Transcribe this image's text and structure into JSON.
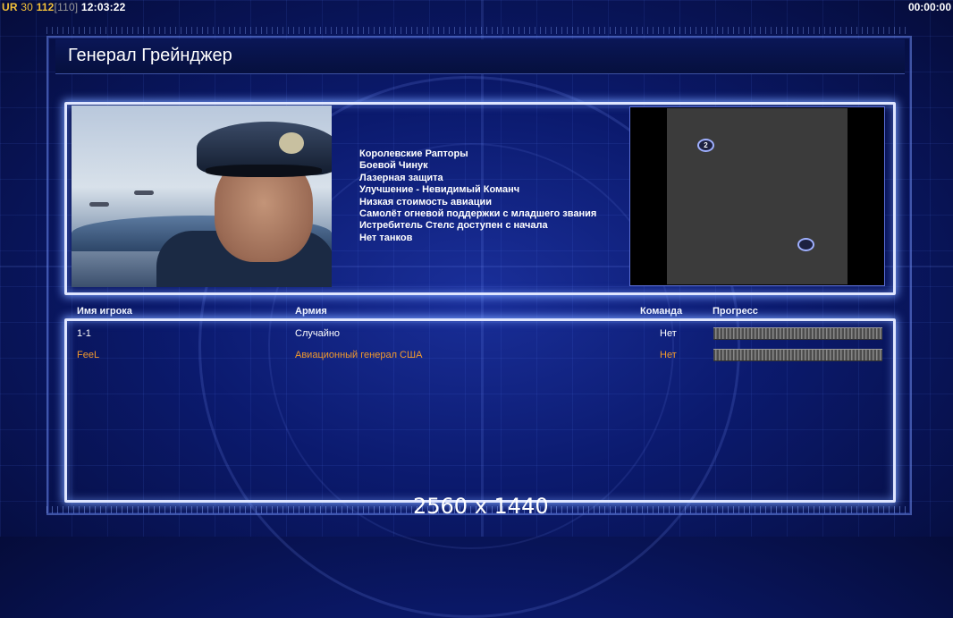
{
  "hud": {
    "prefix": "UR",
    "level": "30",
    "value_a": "112",
    "value_b": "[110]",
    "clock": "12:03:22",
    "timer": "00:00:00"
  },
  "title": "Генерал Грейнджер",
  "perks": [
    "Королевские Рапторы",
    "Боевой Чинук",
    "Лазерная защита",
    "Улучшение - Невидимый Команч",
    "Низкая стоимость авиации",
    "Самолёт огневой поддержки с младшего звания",
    "Истребитель Стелс доступен с начала",
    "Нет танков"
  ],
  "map": {
    "spawn_label": "2"
  },
  "table": {
    "headers": {
      "player": "Имя игрока",
      "army": "Армия",
      "team": "Команда",
      "progress": "Прогресс"
    },
    "rows": [
      {
        "player": "1-1",
        "army": "Случайно",
        "team": "Нет",
        "color": "#ffffff"
      },
      {
        "player": "FeeL",
        "army": "Авиационный генерал США",
        "team": "Нет",
        "color": "#f39a2c"
      }
    ]
  },
  "resolution": "2560 x 1440",
  "colors": {
    "accent_orange": "#f39a2c",
    "hud_yellow": "#f3c13a",
    "panel_border": "#dfe6ff",
    "background": "#0b1a6e"
  }
}
